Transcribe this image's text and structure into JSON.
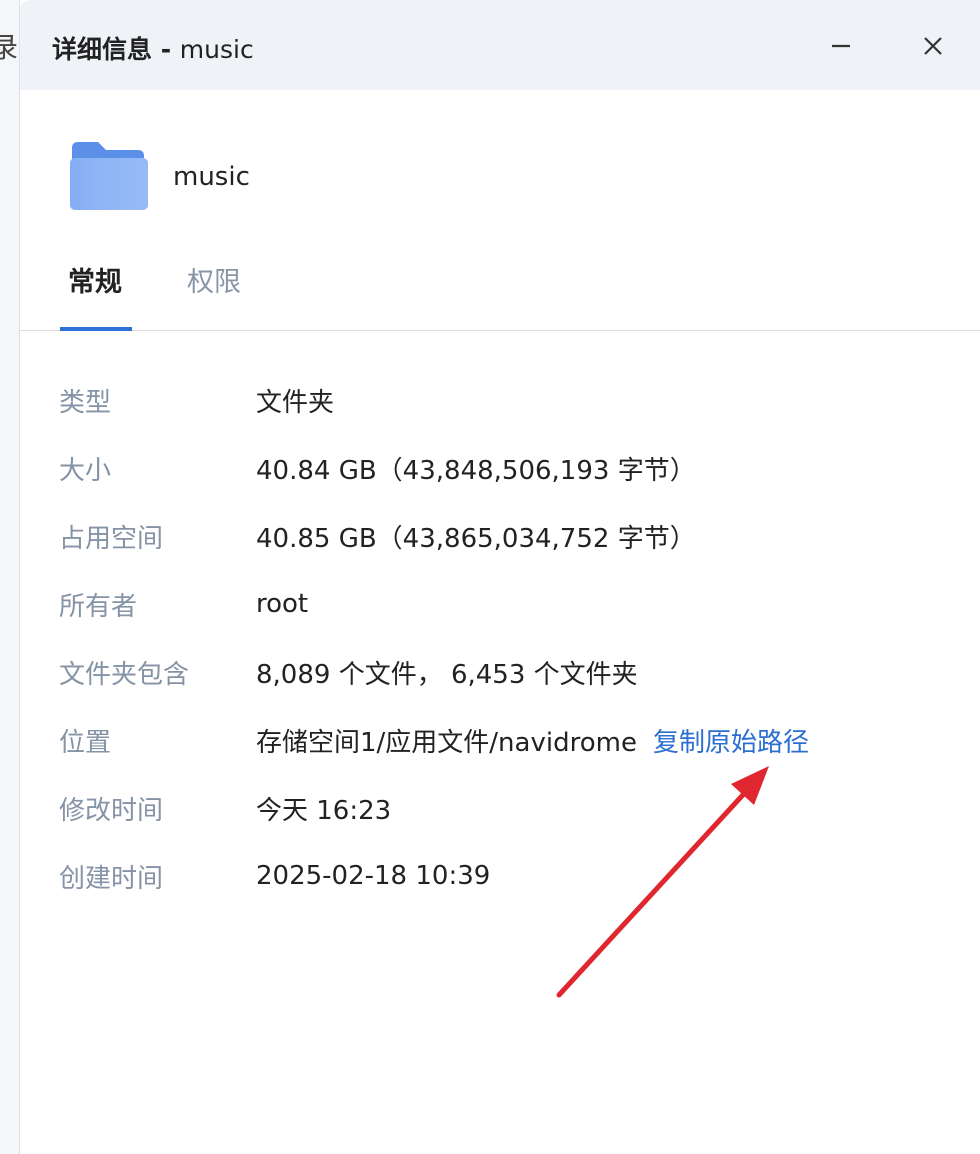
{
  "window": {
    "title_prefix": "详细信息 - ",
    "title_name": "music"
  },
  "item": {
    "name": "music",
    "icon": "folder-icon"
  },
  "tabs": [
    {
      "label": "常规",
      "active": true
    },
    {
      "label": "权限",
      "active": false
    }
  ],
  "properties": {
    "type": {
      "label": "类型",
      "value": "文件夹"
    },
    "size": {
      "label": "大小",
      "value": "40.84 GB（43,848,506,193 字节）"
    },
    "disk_usage": {
      "label": "占用空间",
      "value": "40.85 GB（43,865,034,752 字节）"
    },
    "owner": {
      "label": "所有者",
      "value": "root"
    },
    "contains": {
      "label": "文件夹包含",
      "value": "8,089 个文件， 6,453 个文件夹"
    },
    "location": {
      "label": "位置",
      "value": "存储空间1/应用文件/navidrome",
      "link": "复制原始路径"
    },
    "modified": {
      "label": "修改时间",
      "value": "今天 16:23"
    },
    "created": {
      "label": "创建时间",
      "value": "2025-02-18 10:39"
    }
  },
  "colors": {
    "accent": "#2e72d6",
    "link": "#2c6fd1",
    "label": "#8593a6",
    "annotation_arrow": "#e0262f"
  },
  "background_fragment": "录"
}
